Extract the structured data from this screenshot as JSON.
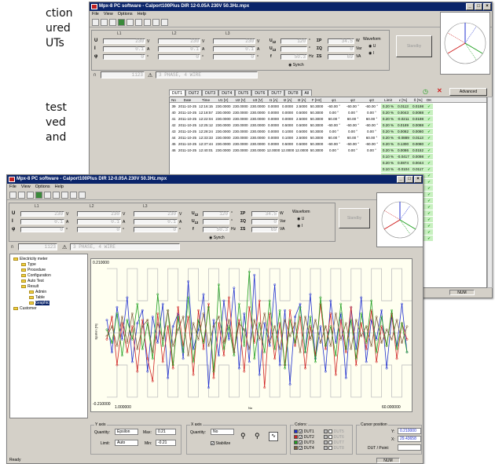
{
  "background_text": {
    "lines_top": [
      "ction",
      "ured",
      "UTs"
    ],
    "lines_mid": [
      "test",
      "ved",
      "and"
    ]
  },
  "back_window": {
    "title": "Mpx-8 PC software - Calport100Plus DIR 12-0.05A 230V 50.3Hz.mpx",
    "menu": [
      "File",
      "View",
      "Options",
      "Help"
    ],
    "meter": {
      "groups": [
        "L1",
        "L2",
        "L3"
      ],
      "rows": [
        {
          "label": "U",
          "values": [
            "230",
            "230",
            "230"
          ],
          "unit": "V"
        },
        {
          "label": "I",
          "values": [
            "0.1",
            "0.1",
            "0.1"
          ],
          "unit": "A"
        },
        {
          "label": "φ",
          "values": [
            "0",
            "0",
            "0"
          ],
          "unit": "°"
        }
      ],
      "u_angles": [
        {
          "label": "U",
          "sub": "12",
          "value": "120",
          "unit": "°"
        },
        {
          "label": "U",
          "sub": "13",
          "value": "",
          "unit": "°"
        }
      ],
      "freq": {
        "label": "f",
        "value": "50.3",
        "unit": "Hz"
      },
      "powers": [
        {
          "label": "ΣP",
          "value": "34.5",
          "unit": "W"
        },
        {
          "label": "ΣQ",
          "value": "0",
          "unit": "Var"
        },
        {
          "label": "ΣS",
          "value": "69",
          "unit": "VA"
        }
      ],
      "synch": "Synch",
      "waveform": {
        "title": "Waveform",
        "options": [
          "U",
          "I"
        ]
      },
      "standby": "Standby",
      "bottom_lcd_left": "1123",
      "bottom_lcd_right": "3 PHASE, 4 WIRE"
    },
    "tabs": [
      "DUT1",
      "DUT2",
      "DUT3",
      "DUT4",
      "DUT5",
      "DUT6",
      "DUT7",
      "DUT8",
      "All"
    ],
    "advanced": "Advanced",
    "columns": [
      "No",
      "Date",
      "Time",
      "U1 [V]",
      "U2 [V]",
      "U3 [V]",
      "I1 [A]",
      "I2 [A]",
      "I3 [A]",
      "F [Hz]",
      "φ1",
      "φ2",
      "φ3",
      "Limit",
      "ε [%]",
      "S̄ [%]",
      "OK"
    ],
    "rows": [
      [
        "39",
        "2011-10-25",
        "12:16:15",
        "230.0000",
        "230.0000",
        "230.0000",
        "0.0000",
        "0.0000",
        "2.5000",
        "50.3000",
        "-60.00 °",
        "-60.00 °",
        "-60.00 °",
        "0.20 %",
        "0.0113",
        "0.0198",
        "✔"
      ],
      [
        "40",
        "2011-10-25",
        "12:18:57",
        "230.0000",
        "230.0000",
        "230.0000",
        "0.0000",
        "0.0000",
        "0.5000",
        "50.3000",
        "0.00 °",
        "0.00 °",
        "0.00 °",
        "0.20 %",
        "0.0043",
        "0.0088",
        "✔"
      ],
      [
        "41",
        "2011-10-25",
        "12:22:04",
        "230.0000",
        "230.0000",
        "230.0000",
        "0.0000",
        "0.0000",
        "2.5000",
        "50.3000",
        "60.00 °",
        "60.00 °",
        "60.00 °",
        "0.20 %",
        "-0.0211",
        "0.0198",
        "✔"
      ],
      [
        "42",
        "2011-10-25",
        "12:25:12",
        "230.0000",
        "230.0000",
        "230.0000",
        "0.0000",
        "0.5000",
        "0.5000",
        "50.3000",
        "-60.00 °",
        "-60.00 °",
        "-60.00 °",
        "0.20 %",
        "0.0189",
        "0.0088",
        "✔"
      ],
      [
        "43",
        "2011-10-25",
        "12:28:24",
        "230.0000",
        "230.0000",
        "230.0000",
        "0.0000",
        "0.1000",
        "0.5000",
        "50.3000",
        "0.00 °",
        "0.00 °",
        "0.00 °",
        "0.20 %",
        "0.0082",
        "0.0080",
        "✔"
      ],
      [
        "44",
        "2011-10-25",
        "12:33:33",
        "230.0000",
        "230.0000",
        "230.0000",
        "0.0000",
        "0.1000",
        "2.5000",
        "50.3000",
        "60.00 °",
        "60.00 °",
        "60.00 °",
        "0.20 %",
        "-0.0889",
        "0.0113",
        "✔"
      ],
      [
        "45",
        "2011-10-25",
        "12:37:44",
        "230.0000",
        "230.0000",
        "230.0000",
        "0.0000",
        "0.5000",
        "0.5000",
        "50.3000",
        "-60.00 °",
        "-60.00 °",
        "-60.00 °",
        "0.20 %",
        "0.1300",
        "0.0080",
        "✔"
      ],
      [
        "46",
        "2011-10-25",
        "12:40:01",
        "230.0000",
        "230.0000",
        "230.0000",
        "12.0000",
        "12.0000",
        "12.0000",
        "50.3000",
        "0.00 °",
        "0.00 °",
        "0.00 °",
        "0.20 %",
        "0.0086",
        "0.0152",
        "✔"
      ]
    ],
    "extra_rows": [
      [
        "0.10 %",
        "-0.0417",
        "0.0098"
      ],
      [
        "0.20 %",
        "0.0874",
        "0.0044"
      ],
      [
        "0.10 %",
        "-0.0104",
        "0.0117"
      ],
      [
        "0.20 %",
        "-0.0434",
        "0.0022"
      ],
      [
        "0.20 %",
        "0.0225",
        "0.0026"
      ],
      [
        "0.10 %",
        "-0.0139",
        "0.0116"
      ],
      [
        "0.20 %",
        "-0.0352",
        "0.0001"
      ],
      [
        "0.20 %",
        "-0.0020",
        "0.0086"
      ],
      [
        "0.10 %",
        "0.0029",
        "0.0000"
      ],
      [
        "0.20 %",
        "-0.0435",
        "0.0106"
      ],
      [
        "0.20 %",
        "0.0239",
        "0.0000"
      ],
      [
        "0.10 %",
        "-0.0186",
        "0.0097"
      ],
      [
        "0.20 %",
        "-0.0829",
        "0.0080"
      ],
      [
        "0.20 %",
        "0.0066",
        "0.0113"
      ]
    ],
    "status_num": "NUM"
  },
  "front_window": {
    "title": "Mpx-8 PC software - Calport100Plus DIR 12-0.05A 230V 50.3Hz.mpx",
    "menu": [
      "File",
      "View",
      "Options",
      "Help"
    ],
    "tree": [
      {
        "label": "Electricity meter",
        "level": 0
      },
      {
        "label": "Type",
        "level": 1
      },
      {
        "label": "Procedure",
        "level": 1
      },
      {
        "label": "Configuration",
        "level": 1
      },
      {
        "label": "Auto Test",
        "level": 1
      },
      {
        "label": "Result",
        "level": 1
      },
      {
        "label": "Admin",
        "level": 2
      },
      {
        "label": "Table",
        "level": 2
      },
      {
        "label": "Graphic",
        "level": 2,
        "selected": true
      },
      {
        "label": "Customer",
        "level": 0
      }
    ],
    "plot": {
      "y_top": "0.210000",
      "y_bottom": "-0.210000",
      "x_left": "1.000000",
      "x_right": "60.000000",
      "x_label": "No",
      "y_label": "Epsilon [%]"
    },
    "y_axis": {
      "title": "Y axis",
      "quantity_label": "Quantity:",
      "quantity": "Epsilon",
      "max_label": "Max:",
      "max": "0.21",
      "limit_label": "Limit:",
      "limit": "Auto",
      "min_label": "Min:",
      "min": "-0.21"
    },
    "x_axis": {
      "title": "X axis",
      "quantity_label": "Quantity:",
      "quantity": "No",
      "stabilize": "Stabilize"
    },
    "colors": {
      "title": "Colors:",
      "items": [
        {
          "label": "DUT1",
          "color": "#2030d0"
        },
        {
          "label": "DUT2",
          "color": "#d02020"
        },
        {
          "label": "DUT3",
          "color": "#20a020"
        },
        {
          "label": "DUT4",
          "color": "#806040"
        },
        {
          "label": "DUT5",
          "color": "#c0c0c0"
        },
        {
          "label": "DUT6",
          "color": "#c0c0c0"
        },
        {
          "label": "DUT7",
          "color": "#c0c0c0"
        },
        {
          "label": "DUT8",
          "color": "#c0c0c0"
        }
      ]
    },
    "cursor": {
      "title": "Cursor position",
      "y_label": "Y:",
      "y": "0.210000",
      "x_label": "X:",
      "x": "29.43658",
      "dut_label": "DUT / Point:"
    },
    "status_ready": "Ready",
    "status_num": "NUM"
  },
  "chart_data": {
    "type": "line",
    "x_range": [
      1,
      60
    ],
    "y_range": [
      -0.21,
      0.21
    ],
    "limit": 0.2,
    "limit_cycle": [
      0.2,
      0.2,
      0.1,
      0.1
    ],
    "series": [
      {
        "color": "#2030d0",
        "values": [
          0.04,
          -0.06,
          0.08,
          -0.02,
          0.11,
          -0.09,
          0.03,
          0.07,
          -0.12,
          0.05,
          -0.03,
          0.09,
          -0.14,
          0.02,
          0.06,
          -0.08,
          0.16,
          -0.05,
          0.01,
          0.12,
          -0.17,
          0.04,
          -0.07,
          0.1,
          -0.02,
          0.14,
          -0.11,
          0.06,
          -0.09,
          0.18,
          -0.13,
          0.03,
          -0.04,
          0.15,
          -0.1,
          0.07,
          -0.16,
          0.05,
          0.09,
          -0.06,
          0.12,
          -0.08,
          0.02,
          -0.12,
          0.1,
          -0.03,
          0.06,
          -0.14,
          0.08,
          -0.05,
          0.11,
          -0.09,
          0.04,
          -0.02,
          0.07,
          -0.11,
          0.05,
          -0.04,
          0.09,
          -0.06
        ]
      },
      {
        "color": "#d02020",
        "values": [
          -0.02,
          0.05,
          -0.1,
          0.03,
          -0.06,
          0.02,
          -0.12,
          0.04,
          -0.08,
          -0.15,
          0.06,
          -0.09,
          0.02,
          -0.11,
          0.08,
          -0.04,
          0.05,
          -0.13,
          0.07,
          -0.05,
          0.09,
          -0.14,
          0.03,
          -0.07,
          0.11,
          -0.06,
          0.04,
          -0.12,
          0.08,
          -0.03,
          0.1,
          -0.17,
          0.06,
          -0.08,
          0.03,
          -0.1,
          0.07,
          -0.04,
          0.05,
          -0.11,
          0.02,
          -0.07,
          0.09,
          -0.05,
          0.06,
          -0.13,
          0.04,
          -0.06,
          0.08,
          -0.1,
          0.03,
          -0.05,
          0.07,
          -0.09,
          0.02,
          -0.04,
          0.06,
          -0.08,
          0.03,
          -0.02
        ]
      },
      {
        "color": "#20a020",
        "values": [
          0.01,
          -0.03,
          0.06,
          -0.07,
          0.04,
          -0.02,
          0.09,
          -0.05,
          0.03,
          -0.08,
          0.12,
          -0.04,
          0.07,
          -0.1,
          0.05,
          -0.06,
          0.11,
          -0.09,
          0.04,
          -0.03,
          0.08,
          -0.12,
          0.15,
          -0.05,
          0.02,
          -0.07,
          0.09,
          -0.04,
          0.19,
          -0.08,
          0.03,
          -0.06,
          0.1,
          -0.05,
          0.07,
          -0.11,
          0.04,
          -0.03,
          0.08,
          -0.06,
          0.05,
          -0.09,
          0.11,
          -0.04,
          0.02,
          -0.07,
          0.09,
          -0.05,
          0.04,
          -0.08,
          0.06,
          -0.03,
          0.1,
          -0.06,
          0.05,
          -0.04,
          0.07,
          -0.05,
          0.03,
          -0.06
        ]
      },
      {
        "color": "#806040",
        "values": [
          -0.01,
          0.02,
          -0.04,
          0.05,
          -0.03,
          0.06,
          -0.05,
          0.02,
          0.04,
          -0.06,
          0.03,
          -0.02,
          0.07,
          -0.04,
          0.01,
          0.05,
          -0.07,
          0.03,
          -0.02,
          0.06,
          -0.04,
          0.02,
          0.05,
          -0.03,
          0.04,
          -0.06,
          0.03,
          0.01,
          -0.05,
          0.04,
          -0.02,
          0.06,
          -0.03,
          0.02,
          -0.05,
          0.04,
          -0.01,
          0.03,
          -0.06,
          0.05,
          -0.02,
          0.04,
          -0.03,
          0.02,
          -0.04,
          0.06,
          -0.02,
          0.03,
          -0.05,
          0.04,
          -0.01,
          0.02,
          -0.04,
          0.05,
          -0.03,
          0.01,
          -0.02,
          0.04,
          -0.03,
          0.02
        ]
      }
    ]
  }
}
